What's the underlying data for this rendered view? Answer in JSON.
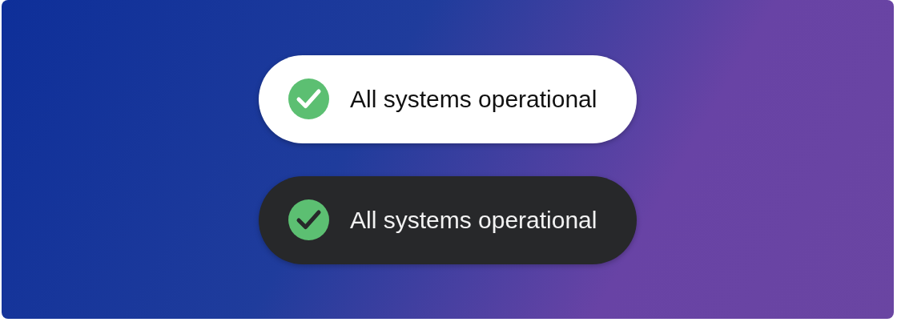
{
  "status_badges": [
    {
      "kind": "light",
      "text": "All systems operational"
    },
    {
      "kind": "dark",
      "text": "All systems operational"
    }
  ]
}
